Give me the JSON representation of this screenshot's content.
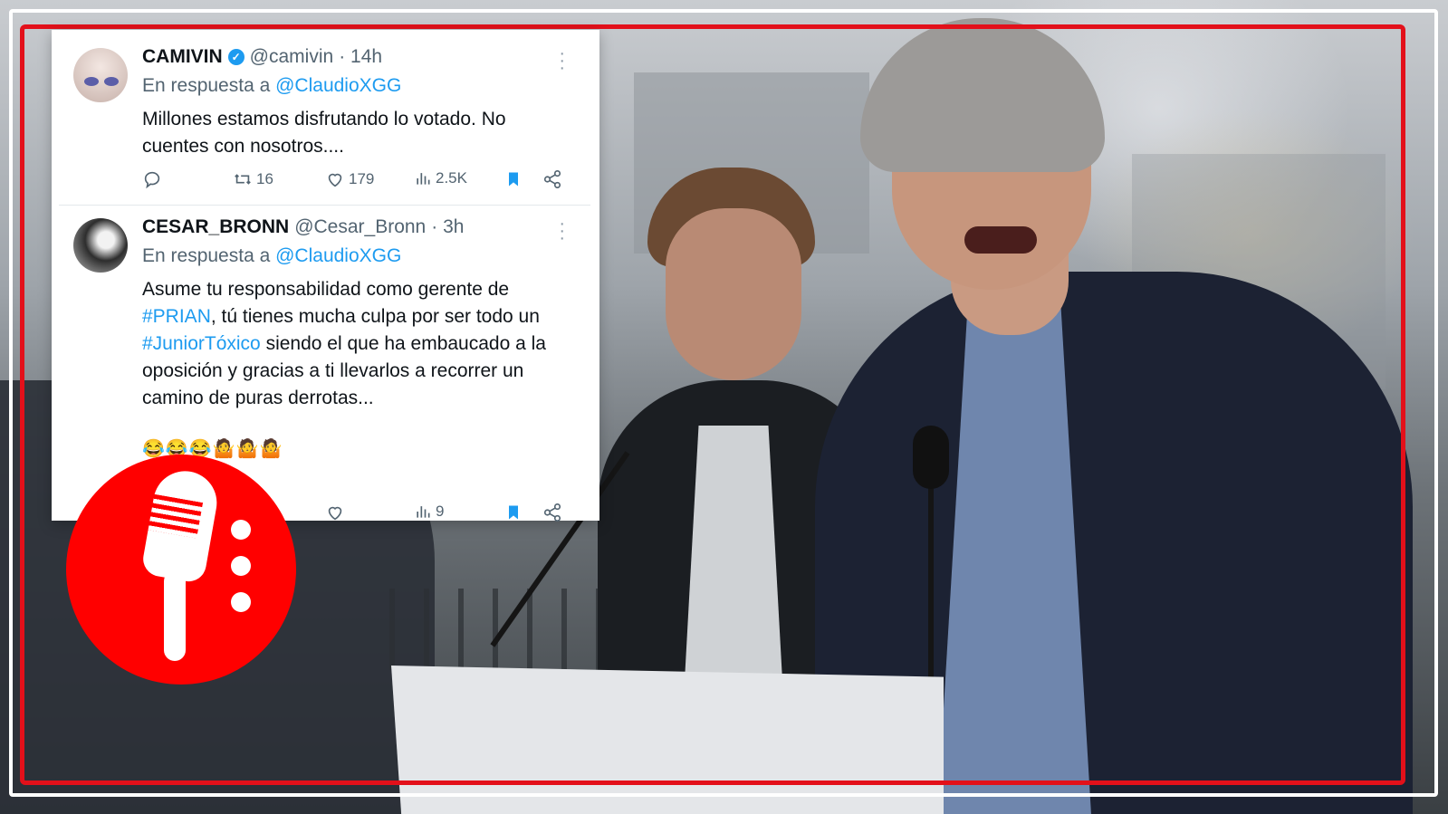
{
  "tweets": [
    {
      "name": "CAMIVIN",
      "handle": "@camivin",
      "time": "· 14h",
      "reply_prefix": "En respuesta a",
      "reply_to": "@ClaudioXGG",
      "text": "Millones estamos disfrutando lo votado. No cuentes con nosotros....",
      "retweets": "16",
      "likes": "179",
      "views": "2.5K"
    },
    {
      "name": "CESAR_BRONN",
      "handle": "@Cesar_Bronn",
      "time": "· 3h",
      "reply_prefix": "En respuesta a",
      "reply_to": "@ClaudioXGG",
      "text_parts": {
        "p1": "Asume tu responsabilidad como gerente de ",
        "tag1": "#PRIAN",
        "p2": ", tú tienes mucha culpa por ser todo un ",
        "tag2": "#JuniorTóxico",
        "p3": " siendo el que ha embaucado a la oposición y gracias a ti llevarlos a recorrer un camino de puras derrotas..."
      },
      "emojis": "😂😂😂🤷🤷🤷",
      "views": "9"
    }
  ],
  "icons": {
    "reply": "reply-icon",
    "retweet": "retweet-icon",
    "like": "heart-icon",
    "views": "views-icon",
    "bookmark": "bookmark-icon",
    "share": "share-icon",
    "verified": "verified-badge-icon",
    "more": "more-icon",
    "logo": "microphone-logo-icon"
  },
  "colors": {
    "frame_red": "#e3101a",
    "link_blue": "#1d9bf0",
    "logo_red": "#ff0000"
  }
}
